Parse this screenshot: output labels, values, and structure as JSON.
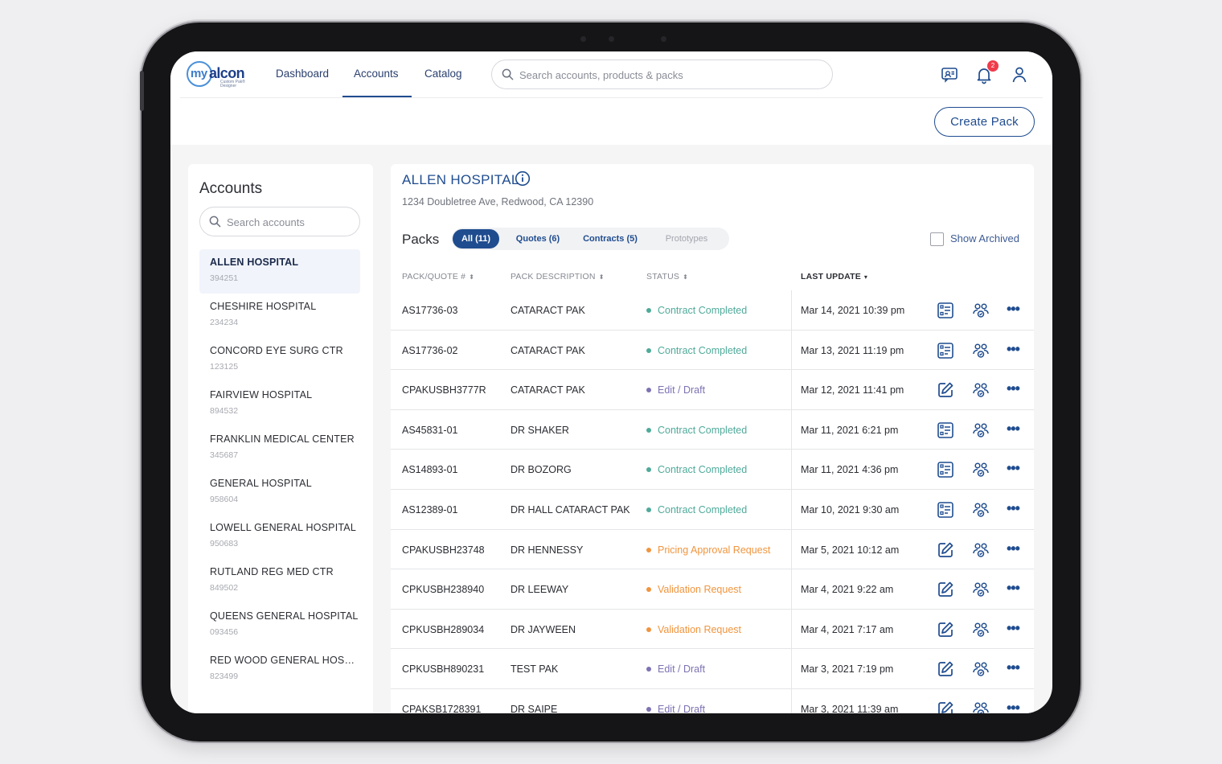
{
  "header": {
    "logo_prefix": "my",
    "logo_brand": "alcon",
    "logo_sub": "Custom Pak® Designer",
    "nav": [
      {
        "label": "Dashboard"
      },
      {
        "label": "Accounts"
      },
      {
        "label": "Catalog"
      }
    ],
    "active_nav": "Accounts",
    "search_placeholder": "Search accounts, products & packs",
    "notification_count": "2",
    "create_pack_label": "Create Pack"
  },
  "accounts": {
    "title": "Accounts",
    "search_placeholder": "Search accounts",
    "items": [
      {
        "name": "ALLEN HOSPITAL",
        "id": "394251",
        "selected": true
      },
      {
        "name": "CHESHIRE HOSPITAL",
        "id": "234234"
      },
      {
        "name": "CONCORD EYE SURG CTR",
        "id": "123125"
      },
      {
        "name": "FAIRVIEW HOSPITAL",
        "id": "894532"
      },
      {
        "name": "FRANKLIN MEDICAL CENTER",
        "id": "345687"
      },
      {
        "name": "GENERAL HOSPITAL",
        "id": "958604"
      },
      {
        "name": "LOWELL GENERAL HOSPITAL",
        "id": "950683"
      },
      {
        "name": "RUTLAND REG MED CTR",
        "id": "849502"
      },
      {
        "name": "QUEENS GENERAL HOSPITAL",
        "id": "093456"
      },
      {
        "name": "RED WOOD GENERAL HOSPI...",
        "id": "823499"
      }
    ]
  },
  "account_detail": {
    "name": "ALLEN HOSPITAL",
    "address": "1234 Doubletree Ave, Redwood, CA 12390",
    "packs_label": "Packs",
    "filters": [
      {
        "label": "All (11)",
        "active": true
      },
      {
        "label": "Quotes (6)"
      },
      {
        "label": "Contracts (5)"
      },
      {
        "label": "Prototypes",
        "disabled": true
      }
    ],
    "show_archived_label": "Show Archived",
    "columns": [
      "PACK/QUOTE #",
      "PACK DESCRIPTION",
      "STATUS",
      "LAST UPDATE"
    ],
    "status_colors": {
      "completed": "#4faa9a",
      "draft": "#7e72b3",
      "pending": "#f0953f"
    },
    "rows": [
      {
        "id": "AS17736-03",
        "desc": "CATARACT PAK",
        "status": "Contract Completed",
        "status_type": "completed",
        "date": "Mar 14, 2021 10:39 pm",
        "icon": "document-icon"
      },
      {
        "id": "AS17736-02",
        "desc": "CATARACT PAK",
        "status": "Contract Completed",
        "status_type": "completed",
        "date": "Mar 13, 2021 11:19 pm",
        "icon": "document-icon"
      },
      {
        "id": "CPAKUSBH3777R",
        "desc": "CATARACT PAK",
        "status": "Edit / Draft",
        "status_type": "draft",
        "date": "Mar 12, 2021 11:41 pm",
        "icon": "edit-icon"
      },
      {
        "id": "AS45831-01",
        "desc": "DR SHAKER",
        "status": "Contract Completed",
        "status_type": "completed",
        "date": "Mar 11, 2021 6:21 pm",
        "icon": "document-icon"
      },
      {
        "id": "AS14893-01",
        "desc": "DR BOZORG",
        "status": "Contract Completed",
        "status_type": "completed",
        "date": "Mar 11, 2021 4:36 pm",
        "icon": "document-icon"
      },
      {
        "id": "AS12389-01",
        "desc": "DR HALL CATARACT PAK",
        "status": "Contract Completed",
        "status_type": "completed",
        "date": "Mar 10, 2021 9:30 am",
        "icon": "document-icon"
      },
      {
        "id": "CPAKUSBH23748",
        "desc": "DR HENNESSY",
        "status": "Pricing Approval Request",
        "status_type": "pending",
        "date": "Mar 5, 2021 10:12 am",
        "icon": "edit-icon"
      },
      {
        "id": "CPKUSBH238940",
        "desc": "DR LEEWAY",
        "status": "Validation Request",
        "status_type": "pending",
        "date": "Mar 4, 2021 9:22 am",
        "icon": "edit-icon"
      },
      {
        "id": "CPKUSBH289034",
        "desc": "DR JAYWEEN",
        "status": "Validation Request",
        "status_type": "pending",
        "date": "Mar 4, 2021 7:17 am",
        "icon": "edit-icon"
      },
      {
        "id": "CPKUSBH890231",
        "desc": "TEST PAK",
        "status": "Edit / Draft",
        "status_type": "draft",
        "date": "Mar 3, 2021 7:19 pm",
        "icon": "edit-icon"
      },
      {
        "id": "CPAKSB1728391",
        "desc": "DR SAIPE",
        "status": "Edit / Draft",
        "status_type": "draft",
        "date": "Mar 3, 2021 11:39 am",
        "icon": "edit-icon"
      }
    ]
  }
}
